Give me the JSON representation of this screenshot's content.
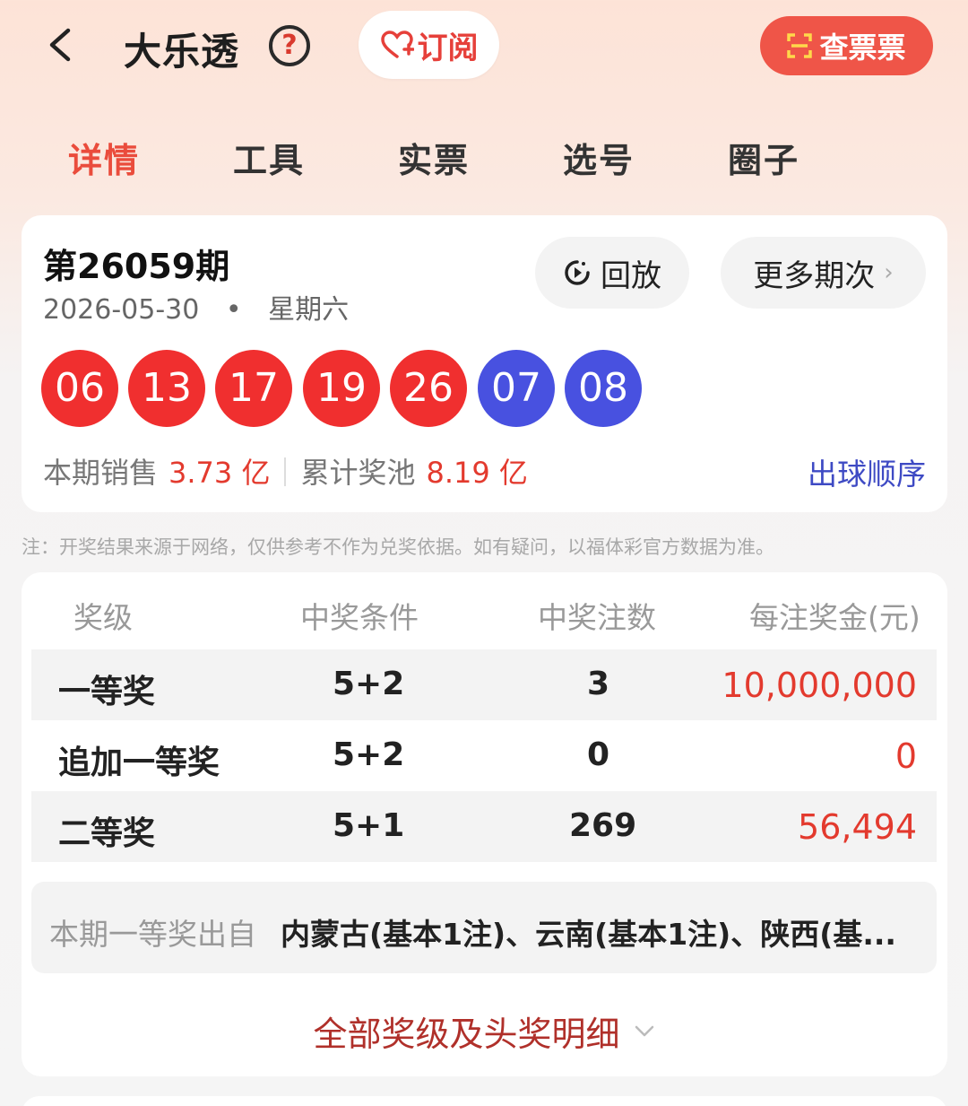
{
  "header": {
    "title": "大乐透",
    "help_glyph": "?",
    "subscribe_label": "订阅",
    "check_ticket_label": "查票票"
  },
  "tabs": [
    {
      "label": "详情",
      "active": true
    },
    {
      "label": "工具",
      "active": false
    },
    {
      "label": "实票",
      "active": false
    },
    {
      "label": "选号",
      "active": false
    },
    {
      "label": "圈子",
      "active": false
    }
  ],
  "draw": {
    "issue": "第26059期",
    "date": "2026-05-30",
    "dot": "•",
    "weekday": "星期六",
    "replay_label": "回放",
    "more_issues_label": "更多期次",
    "front_numbers": [
      "06",
      "13",
      "17",
      "19",
      "26"
    ],
    "back_numbers": [
      "07",
      "08"
    ],
    "sales_label": "本期销售",
    "sales_value": "3.73 亿",
    "pool_label": "累计奖池",
    "pool_value": "8.19 亿",
    "ball_order_label": "出球顺序"
  },
  "note": "注：开奖结果来源于网络，仅供参考不作为兑奖依据。如有疑问，以福体彩官方数据为准。",
  "prize_table": {
    "headers": [
      "奖级",
      "中奖条件",
      "中奖注数",
      "每注奖金(元)"
    ],
    "rows": [
      {
        "level": "一等奖",
        "condition": "5+2",
        "count": "3",
        "amount": "10,000,000"
      },
      {
        "level": "追加一等奖",
        "condition": "5+2",
        "count": "0",
        "amount": "0"
      },
      {
        "level": "二等奖",
        "condition": "5+1",
        "count": "269",
        "amount": "56,494"
      }
    ]
  },
  "winners": {
    "label": "本期一等奖出自",
    "value": "内蒙古(基本1注)、云南(基本1注)、陕西(基..."
  },
  "all_levels_label": "全部奖级及头奖明细",
  "colors": {
    "accent_red": "#ea4c3c",
    "red_ball": "#f02f2f",
    "blue_ball": "#4851e0",
    "link_blue": "#3e4ac4"
  }
}
